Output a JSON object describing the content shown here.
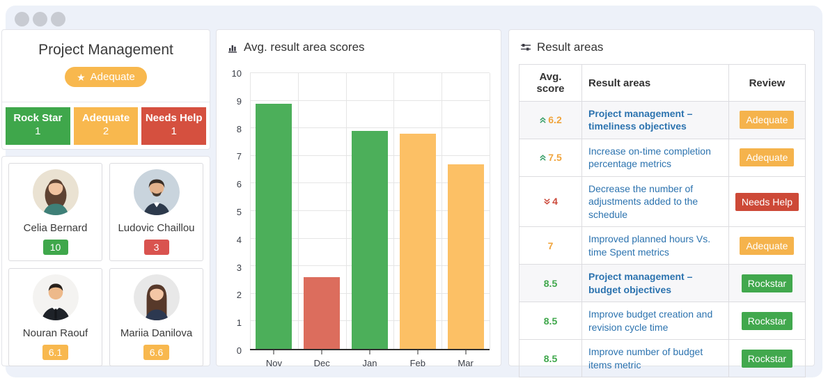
{
  "window": {
    "controls_icon": "window-dots"
  },
  "team": {
    "title": "Project Management",
    "overall_badge": {
      "label": "Adequate",
      "icon": "star-icon",
      "color": "#F8B84E"
    },
    "stats": [
      {
        "label": "Rock Star",
        "count": "1",
        "color": "#3FA74B"
      },
      {
        "label": "Adequate",
        "count": "2",
        "color": "#F8B84E"
      },
      {
        "label": "Needs Help",
        "count": "1",
        "color": "#D5503F"
      }
    ]
  },
  "members": [
    {
      "name": "Celia Bernard",
      "score": "10",
      "score_color": "#3FA74B"
    },
    {
      "name": "Ludovic Chaillou",
      "score": "3",
      "score_color": "#D9534F"
    },
    {
      "name": "Nouran Raouf",
      "score": "6.1",
      "score_color": "#F8B84E"
    },
    {
      "name": "Mariia Danilova",
      "score": "6.6",
      "score_color": "#F8B84E"
    }
  ],
  "chart": {
    "title": "Avg. result area scores",
    "icon": "bar-chart-icon"
  },
  "chart_data": {
    "type": "bar",
    "categories": [
      "Nov",
      "Dec",
      "Jan",
      "Feb",
      "Mar"
    ],
    "values": [
      8.9,
      2.6,
      7.9,
      7.8,
      6.7
    ],
    "colors": [
      "#4CAF5A",
      "#DC6D5D",
      "#4CAF5A",
      "#FCC065",
      "#FCC065"
    ],
    "title": "Avg. result area scores",
    "xlabel": "",
    "ylabel": "",
    "ylim": [
      0,
      10
    ],
    "yticks": [
      0,
      1,
      2,
      3,
      4,
      5,
      6,
      7,
      8,
      9,
      10
    ],
    "grid": true,
    "legend": false
  },
  "results": {
    "title": "Result areas",
    "icon": "sliders-icon",
    "columns": [
      "Avg. score",
      "Result areas",
      "Review"
    ],
    "review_colors": {
      "Adequate": "#F5B34C",
      "Needs Help": "#CD4937",
      "Rockstar": "#41A84D"
    },
    "trend_icons": {
      "up": "double-chevron-up-icon",
      "down": "double-chevron-down-icon"
    },
    "rows": [
      {
        "score": "6.2",
        "score_color": "#F0A43C",
        "trend": "up",
        "area": "Project management – timeliness objectives",
        "review": "Adequate",
        "bold": true
      },
      {
        "score": "7.5",
        "score_color": "#F0A43C",
        "trend": "up",
        "area": "Increase on-time completion percentage metrics",
        "review": "Adequate",
        "bold": false
      },
      {
        "score": "4",
        "score_color": "#CC4A3B",
        "trend": "down",
        "area": "Decrease the number of adjustments added to the schedule",
        "review": "Needs Help",
        "bold": false
      },
      {
        "score": "7",
        "score_color": "#F0A43C",
        "trend": "none",
        "area": "Improved planned hours Vs. time Spent metrics",
        "review": "Adequate",
        "bold": false
      },
      {
        "score": "8.5",
        "score_color": "#3FA74B",
        "trend": "none",
        "area": "Project management – budget objectives",
        "review": "Rockstar",
        "bold": true
      },
      {
        "score": "8.5",
        "score_color": "#3FA74B",
        "trend": "none",
        "area": "Improve budget creation and revision cycle time",
        "review": "Rockstar",
        "bold": false
      },
      {
        "score": "8.5",
        "score_color": "#3FA74B",
        "trend": "none",
        "area": "Improve number of budget items metric",
        "review": "Rockstar",
        "bold": false
      }
    ]
  },
  "colors": {
    "page_background": "#EDF1F9",
    "panel_border": "#E2E3E8",
    "link_blue": "#2C73AF",
    "grid_line": "#E5E5E5",
    "axis_line": "#2F2F2F"
  }
}
